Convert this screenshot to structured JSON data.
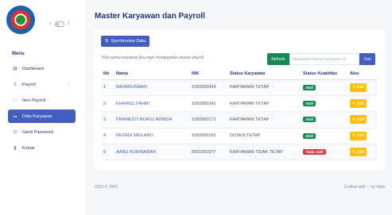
{
  "sidebar": {
    "menu_title": "Menu",
    "items": [
      {
        "label": "Dashboard",
        "icon": "grid-icon",
        "glyph": "▦"
      },
      {
        "label": "Payroll",
        "icon": "dollar-icon",
        "glyph": "$"
      },
      {
        "label": "Item Payroll",
        "icon": "bag-icon",
        "glyph": "▭"
      },
      {
        "label": "Data Karyawan",
        "icon": "users-icon",
        "glyph": "●●"
      },
      {
        "label": "Ganti Password",
        "icon": "key-icon",
        "glyph": "⊡"
      },
      {
        "label": "Keluar",
        "icon": "door-icon",
        "glyph": "▮"
      }
    ]
  },
  "header": {
    "title": "Master Karyawan dan Payroll"
  },
  "toolbar": {
    "sync_label": "Synchronize Data",
    "note": "*Klik nama karyawan jika ingin mengupdate master payroll",
    "refresh_label": "Refresh",
    "search_placeholder": "Masukkan Nama Karyawan Di",
    "search_button": "Cari"
  },
  "table": {
    "headers": [
      "No",
      "Nama",
      "NIK",
      "Status Karyawan",
      "Status Keaktifan",
      "Aksi"
    ],
    "rows": [
      {
        "no": "1",
        "nama": "BADARUSMAN",
        "nik": "1050060343",
        "status": "KARYAWAN TETAP",
        "aktif": "Aktif",
        "aksi": "Edit"
      },
      {
        "no": "2",
        "nama": "KHAIRUL FAHMI",
        "nik": "1050060341",
        "status": "KARYAWAN TETAP",
        "aktif": "Aktif",
        "aksi": "Edit"
      },
      {
        "no": "3",
        "nama": "PRAMESTI NURUL ADINDA",
        "nik": "1050060171",
        "status": "KARYAWAN TETAP",
        "aktif": "Aktif",
        "aksi": "Edit"
      },
      {
        "no": "4",
        "nama": "REZAGI MEILANO",
        "nik": "1050060162",
        "status": "DOSEN TETAP",
        "aktif": "Aktif",
        "aksi": "Edit"
      },
      {
        "no": "5",
        "nama": "AANG KURNIAWAN",
        "nik": "0001091977",
        "status": "KARYAWAN TIDAK TETAP",
        "aktif": "Tidak Aktif",
        "aksi": "Edit"
      }
    ]
  },
  "footer": {
    "copyright": "2023 © TRPL",
    "crafted_prefix": "Crafted with",
    "crafted_suffix": "by",
    "crafted_by": "fdtsk"
  },
  "colors": {
    "primary": "#435ebe",
    "success": "#198754",
    "danger": "#dc3545",
    "warning": "#ffc107"
  }
}
